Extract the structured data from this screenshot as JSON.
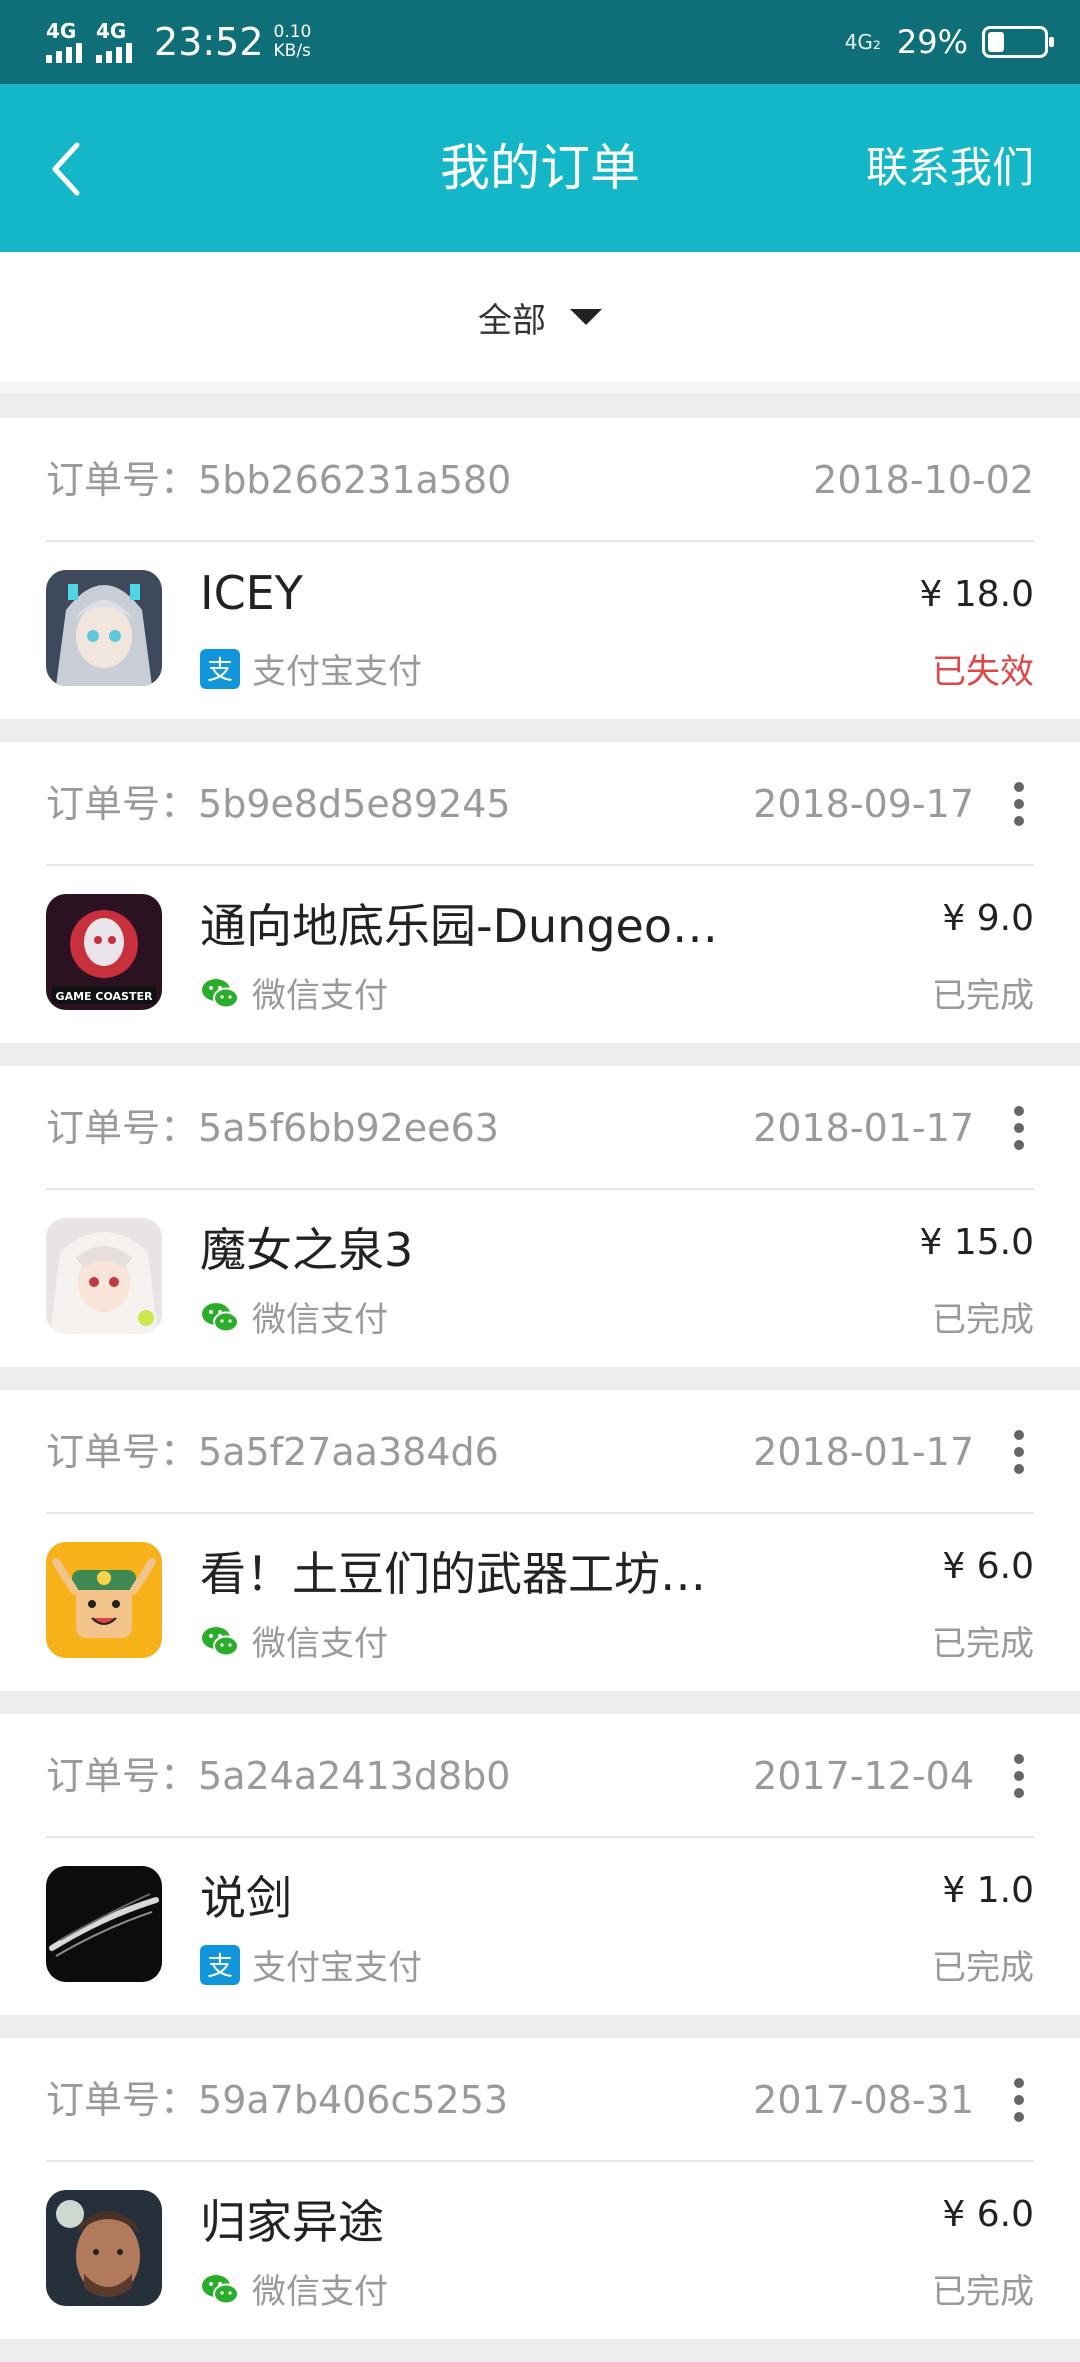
{
  "status_bar": {
    "network_1": "4G",
    "network_2": "4G",
    "time": "23:52",
    "speed_value": "0.10",
    "speed_unit": "KB/s",
    "right_network": "4G₂",
    "battery_text": "29%",
    "battery_level": 0.29
  },
  "header": {
    "title": "我的订单",
    "contact": "联系我们"
  },
  "filter": {
    "label": "全部"
  },
  "colors": {
    "header_bg": "#14b7c7",
    "status_bar_bg": "#0e6f79",
    "invalid_status": "#e04848",
    "alipay": "#1296db",
    "wechat": "#2aae2a"
  },
  "orders": [
    {
      "order_label": "订单号：",
      "order_id": "5bb266231a580",
      "date": "2018-10-02",
      "game": "ICEY",
      "pay_method": "支付宝支付",
      "pay_icon": "alipay-icon",
      "price": "¥ 18.0",
      "status": "已失效"
    },
    {
      "order_label": "订单号：",
      "order_id": "5b9e8d5e89245",
      "date": "2018-09-17",
      "game": "通向地底乐园-Dungeo…",
      "pay_method": "微信支付",
      "pay_icon": "wechat-icon",
      "price": "¥ 9.0",
      "status": "已完成"
    },
    {
      "order_label": "订单号：",
      "order_id": "5a5f6bb92ee63",
      "date": "2018-01-17",
      "game": "魔女之泉3",
      "pay_method": "微信支付",
      "pay_icon": "wechat-icon",
      "price": "¥ 15.0",
      "status": "已完成"
    },
    {
      "order_label": "订单号：",
      "order_id": "5a5f27aa384d6",
      "date": "2018-01-17",
      "game": "看！土豆们的武器工坊…",
      "pay_method": "微信支付",
      "pay_icon": "wechat-icon",
      "price": "¥ 6.0",
      "status": "已完成"
    },
    {
      "order_label": "订单号：",
      "order_id": "5a24a2413d8b0",
      "date": "2017-12-04",
      "game": "说剑",
      "pay_method": "支付宝支付",
      "pay_icon": "alipay-icon",
      "price": "¥ 1.0",
      "status": "已完成"
    },
    {
      "order_label": "订单号：",
      "order_id": "59a7b406c5253",
      "date": "2017-08-31",
      "game": "归家异途",
      "pay_method": "微信支付",
      "pay_icon": "wechat-icon",
      "price": "¥ 6.0",
      "status": "已完成"
    }
  ]
}
